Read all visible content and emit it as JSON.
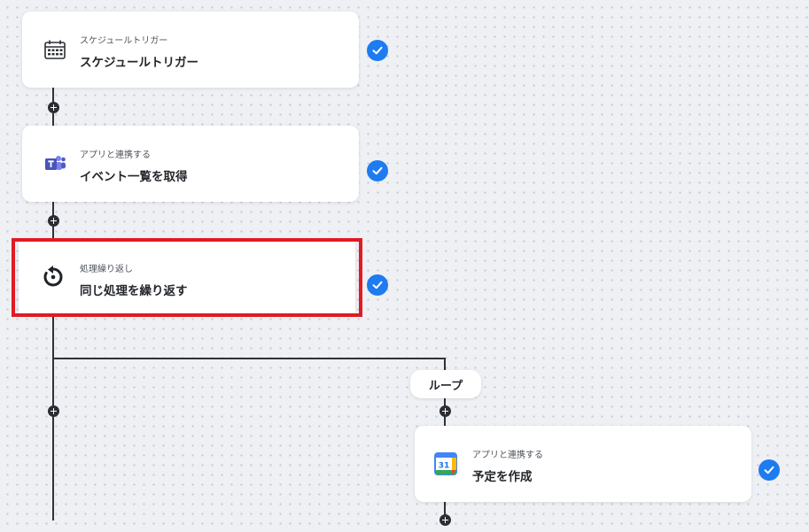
{
  "flow": {
    "steps": [
      {
        "subtitle": "スケジュールトリガー",
        "title": "スケジュールトリガー",
        "icon": "schedule-calendar-icon",
        "status": "complete"
      },
      {
        "subtitle": "アプリと連携する",
        "title": "イベント一覧を取得",
        "icon": "teams-icon",
        "status": "complete"
      },
      {
        "subtitle": "処理繰り返し",
        "title": "同じ処理を繰り返す",
        "icon": "loop-icon",
        "status": "complete",
        "highlighted": true
      },
      {
        "subtitle": "アプリと連携する",
        "title": "予定を作成",
        "icon": "google-calendar-icon",
        "status": "complete"
      }
    ],
    "loop_label": "ループ",
    "calendar_day": "31"
  },
  "colors": {
    "check_blue": "#1e7bf0",
    "highlight_red": "#e01b22",
    "connector": "#2f3238"
  }
}
